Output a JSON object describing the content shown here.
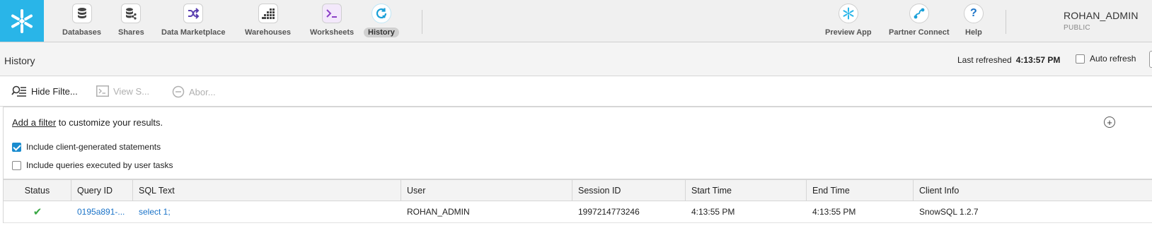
{
  "nav": {
    "items": [
      {
        "label": "Databases",
        "icon": "database-icon"
      },
      {
        "label": "Shares",
        "icon": "shares-icon"
      },
      {
        "label": "Data Marketplace",
        "icon": "marketplace-icon"
      },
      {
        "label": "Warehouses",
        "icon": "warehouse-icon"
      },
      {
        "label": "Worksheets",
        "icon": "terminal-icon"
      },
      {
        "label": "History",
        "icon": "history-icon",
        "active": true
      }
    ],
    "right_items": [
      {
        "label": "Preview App",
        "icon": "snowflake-icon"
      },
      {
        "label": "Partner Connect",
        "icon": "partner-connect-icon"
      },
      {
        "label": "Help",
        "icon": "help-icon"
      }
    ],
    "account": {
      "name": "ROHAN_ADMIN",
      "role": "PUBLIC"
    }
  },
  "header": {
    "title": "History",
    "last_refreshed_label": "Last refreshed",
    "last_refreshed_time": "4:13:57 PM",
    "auto_refresh_label": "Auto refresh",
    "auto_refresh_checked": false
  },
  "toolbar": {
    "hide_filters": "Hide Filte...",
    "view_sql": "View S...",
    "abort": "Abor..."
  },
  "filters": {
    "add_filter_link": "Add a filter",
    "hint_rest": " to customize your results.",
    "options": [
      {
        "label": "Include client-generated statements",
        "checked": true
      },
      {
        "label": "Include queries executed by user tasks",
        "checked": false
      }
    ]
  },
  "table": {
    "columns": [
      "Status",
      "Query ID",
      "SQL Text",
      "User",
      "Session ID",
      "Start Time",
      "End Time",
      "Client Info"
    ],
    "rows": [
      {
        "status": "success",
        "status_glyph": "✔",
        "query_id": "0195a891-...",
        "sql_text": "select 1;",
        "user": "ROHAN_ADMIN",
        "session_id": "1997214773246",
        "start_time": "4:13:55 PM",
        "end_time": "4:13:55 PM",
        "client_info": "SnowSQL 1.2.7"
      }
    ]
  },
  "colors": {
    "brand": "#29b5e8",
    "link": "#1a73c8",
    "success": "#3aa845",
    "checkbox": "#1a8ccf"
  }
}
